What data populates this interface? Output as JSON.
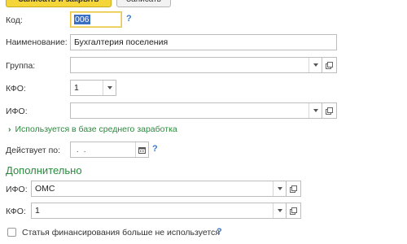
{
  "toolbar": {
    "save_close_label": "Записать и закрыть",
    "save_label": "Записать"
  },
  "form": {
    "code": {
      "label": "Код:",
      "value": "006"
    },
    "name": {
      "label": "Наименование:",
      "value": "Бухгалтерия поселения"
    },
    "group": {
      "label": "Группа:",
      "value": ""
    },
    "kfo": {
      "label": "КФО:",
      "value": "1"
    },
    "ifo": {
      "label": "ИФО:",
      "value": ""
    },
    "avg_salary_link": "Используется в базе среднего заработка",
    "valid_to": {
      "label": "Действует по:",
      "value": " .  ."
    }
  },
  "additional": {
    "title": "Дополнительно",
    "ifo": {
      "label": "ИФО:",
      "value": "ОМС"
    },
    "kfo": {
      "label": "КФО:",
      "value": "1"
    }
  },
  "checkbox": {
    "label": "Статья финансирования больше не используется",
    "checked": false
  },
  "help_mark": "?",
  "colors": {
    "accent_green": "#2a8a3c",
    "help_blue": "#3a78c9",
    "primary_button": "#f5d63a",
    "focus_border": "#e8c441"
  }
}
